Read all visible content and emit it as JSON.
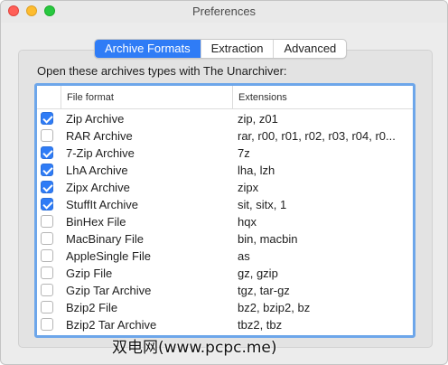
{
  "window": {
    "title": "Preferences"
  },
  "tabs": [
    {
      "label": "Archive Formats",
      "active": true
    },
    {
      "label": "Extraction",
      "active": false
    },
    {
      "label": "Advanced",
      "active": false
    }
  ],
  "intro_text": "Open these archives types with The Unarchiver:",
  "table": {
    "columns": [
      "",
      "File format",
      "Extensions"
    ],
    "rows": [
      {
        "checked": true,
        "format": "Zip Archive",
        "extensions": "zip, z01"
      },
      {
        "checked": false,
        "format": "RAR Archive",
        "extensions": "rar, r00, r01, r02, r03, r04, r0..."
      },
      {
        "checked": true,
        "format": "7-Zip Archive",
        "extensions": "7z"
      },
      {
        "checked": true,
        "format": "LhA Archive",
        "extensions": "lha, lzh"
      },
      {
        "checked": true,
        "format": "Zipx Archive",
        "extensions": "zipx"
      },
      {
        "checked": true,
        "format": "StuffIt Archive",
        "extensions": "sit, sitx, 1"
      },
      {
        "checked": false,
        "format": "BinHex File",
        "extensions": "hqx"
      },
      {
        "checked": false,
        "format": "MacBinary File",
        "extensions": "bin, macbin"
      },
      {
        "checked": false,
        "format": "AppleSingle File",
        "extensions": "as"
      },
      {
        "checked": false,
        "format": "Gzip File",
        "extensions": "gz, gzip"
      },
      {
        "checked": false,
        "format": "Gzip Tar Archive",
        "extensions": "tgz, tar-gz"
      },
      {
        "checked": false,
        "format": "Bzip2 File",
        "extensions": "bz2, bzip2, bz"
      },
      {
        "checked": false,
        "format": "Bzip2 Tar Archive",
        "extensions": "tbz2, tbz"
      }
    ]
  },
  "watermark": "双电网(www.pcpc.me)",
  "colors": {
    "accent": "#2f7cf6",
    "focus_ring": "#6da6ea"
  }
}
